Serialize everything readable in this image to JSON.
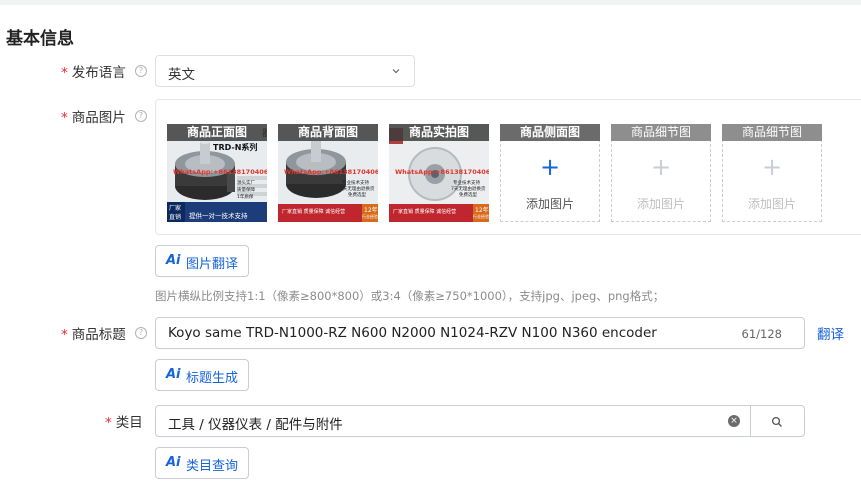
{
  "section": {
    "title": "基本信息"
  },
  "language": {
    "label": "发布语言",
    "required": "*",
    "help": "?",
    "selected": "英文"
  },
  "images": {
    "label": "商品图片",
    "required": "*",
    "help": "?",
    "slots": [
      {
        "caption": "商品正面图",
        "state": "filled"
      },
      {
        "caption": "商品背面图",
        "state": "filled"
      },
      {
        "caption": "商品实拍图",
        "state": "filled"
      },
      {
        "caption": "商品侧面图",
        "state": "empty-active",
        "plus": "+",
        "add_text": "添加图片"
      },
      {
        "caption": "商品细节图",
        "state": "empty-disabled",
        "plus": "+",
        "add_text": "添加图片"
      },
      {
        "caption": "商品细节图",
        "state": "empty-disabled",
        "plus": "+",
        "add_text": "添加图片"
      }
    ],
    "photo_text": {
      "series": "TRD-N系列",
      "brand_tag": "器",
      "whatsapp": "WhatsApp:+8613817040688",
      "side1": "源头实厂",
      "side2": "质量保障",
      "side3": "1年质保",
      "side4": "专业技术支持",
      "side5": "7天无理由退换货",
      "side6": "免费选型",
      "corner_a": "厂家",
      "corner_b": "直销",
      "footer": "提供一对一技术支持",
      "footer2": "厂家直销  质量保障  诚信经营",
      "years": "12年",
      "years_sub": "行业经验"
    },
    "translate_button": {
      "ai": "Ai",
      "label": "图片翻译"
    },
    "hint": "图片横纵比例支持1:1（像素≥800*800）或3:4（像素≥750*1000），支持jpg、jpeg、png格式；"
  },
  "title_field": {
    "label": "商品标题",
    "required": "*",
    "help": "?",
    "value": "Koyo same TRD-N1000-RZ N600 N2000 N1024-RZV N100 N360 encoder",
    "count": "61/128",
    "translate_link": "翻译",
    "generate_button": {
      "ai": "Ai",
      "label": "标题生成"
    }
  },
  "category": {
    "label": "类目",
    "required": "*",
    "value": "工具 / 仪器仪表 / 配件与附件",
    "clear": "×",
    "query_button": {
      "ai": "Ai",
      "label": "类目查询"
    }
  },
  "colors": {
    "accent": "#1664d9",
    "required": "#f5222d",
    "border": "#c9cdd4"
  },
  "icons": [
    "help-icon",
    "chevron-down-icon",
    "plus-icon",
    "clear-icon",
    "search-icon"
  ]
}
